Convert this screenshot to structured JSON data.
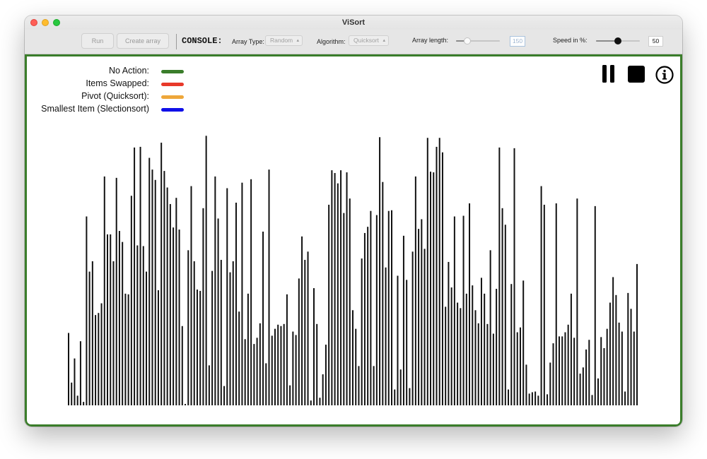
{
  "window": {
    "title": "ViSort"
  },
  "toolbar": {
    "run_label": "Run",
    "create_array_label": "Create array",
    "console_label": "CONSOLE:",
    "array_type_label": "Array Type:",
    "array_type_value": "Random",
    "algorithm_label": "Algorithm:",
    "algorithm_value": "Quicksort",
    "array_length_label": "Array length:",
    "array_length_value": "150",
    "array_length_slider_fraction": 0.26,
    "speed_label": "Speed in %:",
    "speed_value": "50",
    "speed_slider_fraction": 0.5
  },
  "legend": [
    {
      "label": "No Action:",
      "color": "#3a7d2a"
    },
    {
      "label": "Items Swapped:",
      "color": "#e8392a"
    },
    {
      "label": "Pivot (Quicksort):",
      "color": "#eea73a"
    },
    {
      "label": "Smallest Item (Slectionsort)",
      "color": "#1010e8"
    }
  ],
  "controls": {
    "pause_icon": "pause-icon",
    "stop_icon": "stop-icon",
    "info_icon": "info-icon"
  },
  "bars": {
    "max_value": 420,
    "default_color": "#111111",
    "values": [
      105,
      33,
      68,
      14,
      93,
      5,
      274,
      194,
      209,
      131,
      134,
      148,
      332,
      248,
      248,
      209,
      330,
      253,
      237,
      162,
      161,
      304,
      374,
      232,
      375,
      231,
      194,
      359,
      342,
      327,
      167,
      381,
      340,
      316,
      292,
      258,
      301,
      255,
      115,
      2,
      225,
      318,
      209,
      168,
      166,
      286,
      391,
      58,
      195,
      332,
      271,
      211,
      28,
      315,
      193,
      209,
      294,
      136,
      323,
      96,
      162,
      328,
      89,
      98,
      119,
      252,
      61,
      342,
      101,
      111,
      117,
      115,
      118,
      161,
      29,
      107,
      102,
      184,
      245,
      211,
      223,
      7,
      170,
      118,
      11,
      45,
      88,
      291,
      341,
      337,
      322,
      341,
      279,
      338,
      300,
      138,
      111,
      57,
      213,
      250,
      259,
      282,
      57,
      276,
      389,
      324,
      200,
      282,
      283,
      23,
      188,
      52,
      246,
      182,
      25,
      223,
      332,
      256,
      270,
      227,
      388,
      339,
      338,
      375,
      388,
      367,
      143,
      208,
      171,
      274,
      149,
      141,
      275,
      162,
      293,
      174,
      138,
      119,
      185,
      162,
      118,
      225,
      104,
      169,
      374,
      286,
      262,
      23,
      176,
      373,
      106,
      113,
      181,
      59,
      17,
      19,
      20,
      14,
      318,
      291,
      16,
      62,
      90,
      293,
      100,
      100,
      106,
      117,
      162,
      98,
      300,
      46,
      55,
      81,
      95,
      15,
      289,
      39,
      99,
      83,
      111,
      149,
      186,
      160,
      120,
      107,
      20,
      163,
      140,
      107,
      205
    ],
    "note": ""
  }
}
